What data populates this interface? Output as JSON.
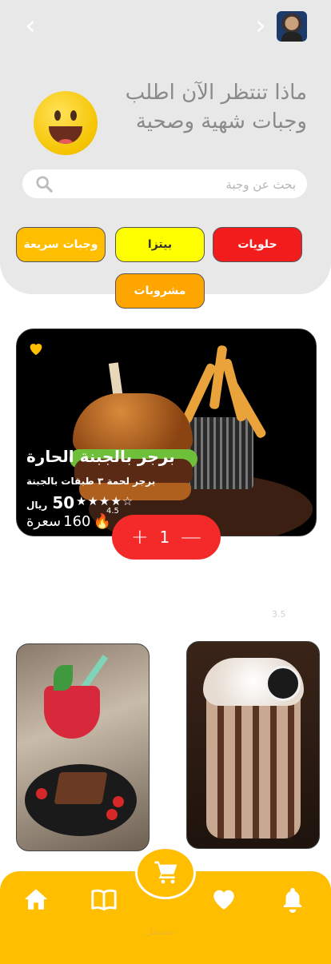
{
  "header": {
    "headline": "ماذا تنتظر الآن اطلب وجبات شهية وصحية"
  },
  "search": {
    "placeholder": "بحث عن وجبة"
  },
  "categories": [
    {
      "label": "حلويات",
      "color": "#f21c1c"
    },
    {
      "label": "بيتزا",
      "color": "#ffff00"
    },
    {
      "label": "وجبات سريعة",
      "color": "#ffbf00"
    },
    {
      "label": "مشروبات",
      "color": "#ffa500"
    }
  ],
  "featured": {
    "title": "برجر بالجبنة الحارة",
    "description": "برجر لحمة ٣ طبقات بالجبنة",
    "price": "50",
    "currency": "ريال",
    "rating": "4.5",
    "calories": "160",
    "calories_unit": "سعرة",
    "quantity": "1"
  },
  "ghost_text": "3.5",
  "watermark": "مستقل",
  "colors": {
    "accent": "#ffbf00",
    "red": "#f42a2a",
    "header_bg": "#e8e8e8"
  }
}
